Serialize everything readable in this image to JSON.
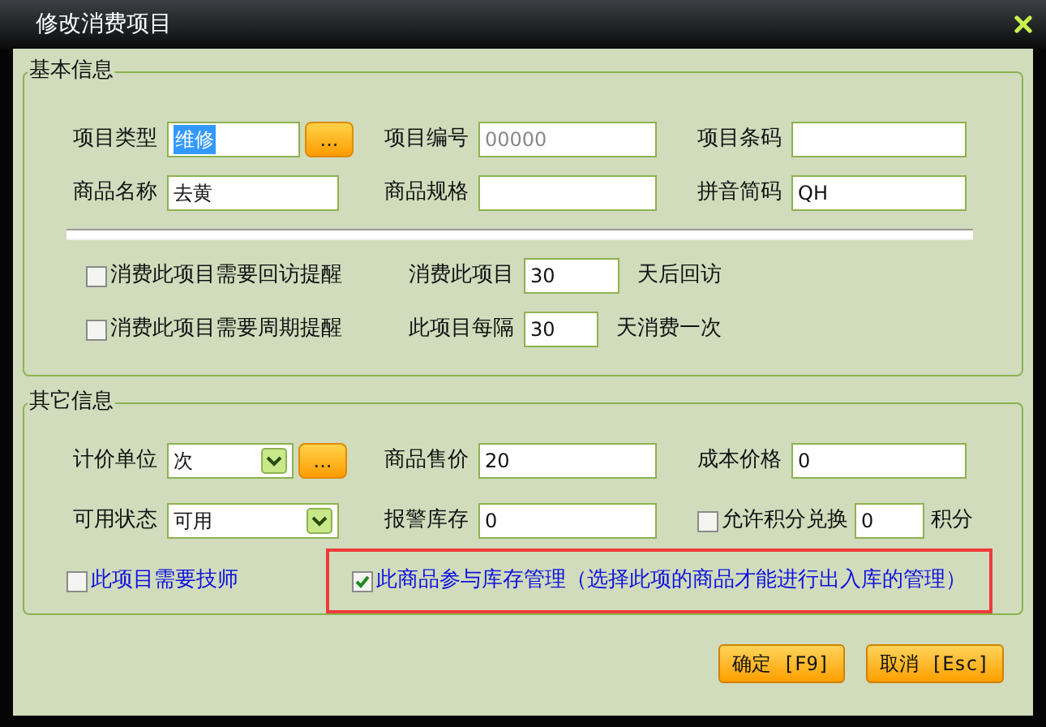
{
  "window": {
    "title": "修改消费项目"
  },
  "groups": [
    {
      "title": "基本信息",
      "rows": [
        {
          "kind": "fields",
          "items": [
            {
              "kind": "text_field",
              "label": "项目类型",
              "value": "维修",
              "text_selected": true,
              "picker": "..."
            },
            {
              "kind": "text_field",
              "label": "项目编号",
              "placeholder": "00000"
            },
            {
              "kind": "text_field",
              "label": "项目条码"
            }
          ]
        },
        {
          "kind": "fields",
          "items": [
            {
              "kind": "text_field",
              "label": "商品名称",
              "value": "去黄"
            },
            {
              "kind": "text_field",
              "label": "商品规格"
            },
            {
              "kind": "text_field",
              "label": "拼音简码",
              "value": "QH"
            }
          ]
        },
        {
          "kind": "divider"
        },
        {
          "kind": "fields",
          "items": [
            {
              "kind": "checkbox",
              "label": "消费此项目需要回访提醒",
              "checked": false
            },
            {
              "kind": "text_field",
              "label": "消费此项目",
              "value": "30",
              "suffix": "天后回访"
            }
          ]
        },
        {
          "kind": "fields",
          "items": [
            {
              "kind": "checkbox",
              "label": "消费此项目需要周期提醒",
              "checked": false
            },
            {
              "kind": "text_field",
              "label": "此项目每隔",
              "value": "30",
              "suffix": "天消费一次"
            }
          ]
        }
      ]
    },
    {
      "title": "其它信息",
      "rows": [
        {
          "kind": "fields",
          "items": [
            {
              "kind": "select_field",
              "label": "计价单位",
              "value": "次",
              "picker": "..."
            },
            {
              "kind": "text_field",
              "label": "商品售价",
              "value": "20"
            },
            {
              "kind": "text_field",
              "label": "成本价格",
              "value": "0"
            }
          ]
        },
        {
          "kind": "fields",
          "items": [
            {
              "kind": "select_field",
              "label": "可用状态",
              "value": "可用"
            },
            {
              "kind": "text_field",
              "label": "报警库存",
              "value": "0"
            },
            {
              "kind": "check_field",
              "label": "允许积分兑换",
              "checked": false,
              "value": "0",
              "suffix": "积分"
            }
          ]
        },
        {
          "kind": "fields",
          "items": [
            {
              "kind": "checkbox",
              "label": "此项目需要技师",
              "checked": false,
              "accent": true
            },
            {
              "kind": "checkbox",
              "label": "此商品参与库存管理（选择此项的商品才能进行出入库的管理）",
              "checked": true,
              "accent": true,
              "highlighted": true
            }
          ]
        }
      ]
    }
  ],
  "buttons": [
    {
      "label": "确定 [F9]"
    },
    {
      "label": "取消 [Esc]"
    }
  ]
}
